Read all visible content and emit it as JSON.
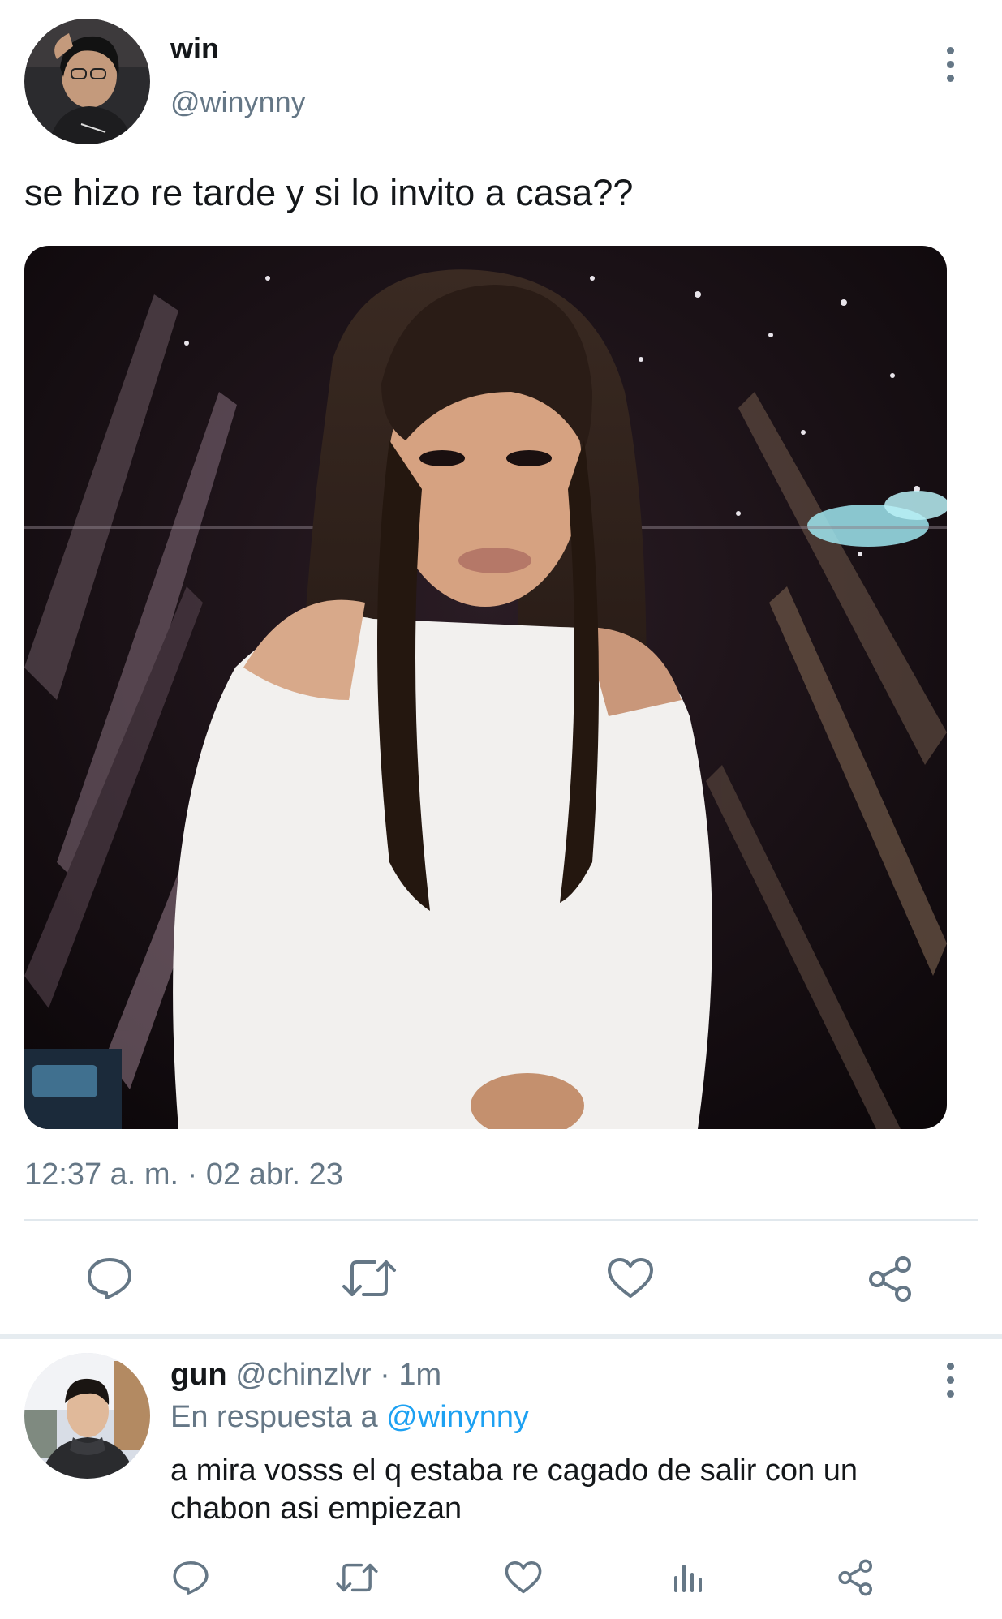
{
  "tweet": {
    "author_name": "win",
    "author_handle": "@winynny",
    "text": "se hizo re tarde y si lo invito a casa??",
    "timestamp": "12:37 a. m. · 02 abr. 23",
    "actions": [
      "reply-icon",
      "retweet-icon",
      "like-icon",
      "share-icon"
    ]
  },
  "reply": {
    "author_name": "gun",
    "author_handle": "@chinzlvr",
    "separator": "·",
    "time": "1m",
    "in_reply_prefix": "En respuesta a",
    "in_reply_handle": "@winynny",
    "text": "a mira vosss el q estaba re cagado de salir con un chabon asi empiezan",
    "actions": [
      "reply-icon",
      "retweet-icon",
      "like-icon",
      "analytics-icon",
      "share-icon"
    ]
  },
  "colors": {
    "text": "#14171a",
    "muted": "#657786",
    "link": "#1da1f2",
    "divider": "#e1e8ed"
  }
}
